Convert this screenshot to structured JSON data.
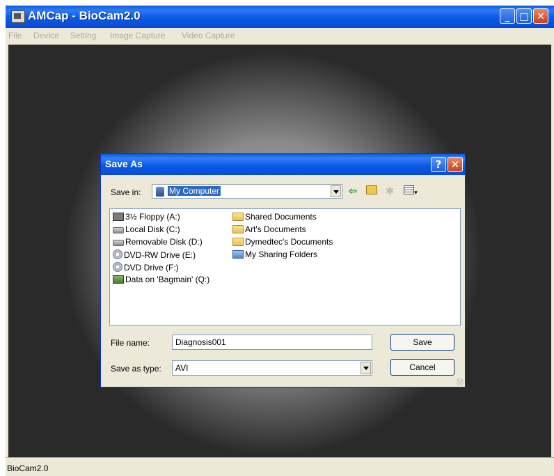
{
  "app": {
    "title": "AMCap - BioCam2.0",
    "status": "BioCam2.0"
  },
  "menu": [
    "File",
    "Device",
    "Setting",
    "Image Capture",
    "Video Capture"
  ],
  "dialog": {
    "title": "Save As",
    "save_in_label": "Save in:",
    "save_in_value": "My Computer",
    "help": "?",
    "items_col1": [
      {
        "label": "3½ Floppy (A:)",
        "icon": "floppy-icon"
      },
      {
        "label": "Local Disk (C:)",
        "icon": "drive-icon"
      },
      {
        "label": "Removable Disk (D:)",
        "icon": "drive-icon"
      },
      {
        "label": "DVD-RW Drive (E:)",
        "icon": "cd-icon"
      },
      {
        "label": "DVD Drive (F:)",
        "icon": "cd-icon"
      },
      {
        "label": "Data on 'Bagmain' (Q:)",
        "icon": "network-drive-icon"
      }
    ],
    "items_col2": [
      {
        "label": "Shared Documents",
        "icon": "folder-icon"
      },
      {
        "label": "Art's Documents",
        "icon": "folder-icon"
      },
      {
        "label": "Dymedtec's Documents",
        "icon": "folder-icon"
      },
      {
        "label": "My Sharing Folders",
        "icon": "shared-folder-icon"
      }
    ],
    "file_name_label": "File name:",
    "file_name_value": "Diagnosis001",
    "save_type_label": "Save as type:",
    "save_type_value": "AVI",
    "save_button": "Save",
    "cancel_button": "Cancel"
  },
  "colors": {
    "titlebar": "#0a5be3",
    "selection": "#316ac5",
    "dialog_bg": "#ece9d8"
  }
}
